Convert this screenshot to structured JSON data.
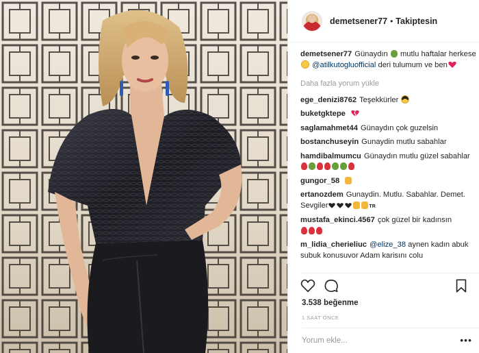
{
  "header": {
    "username": "demetsener77",
    "separator": "•",
    "follow_status": "Takiptesin"
  },
  "caption": {
    "user": "demetsener77",
    "text_1": "Günaydın",
    "text_2": "mutlu haftalar herkese",
    "mention": "@atilkutogluofficial",
    "text_3": "deri tulumum ve ben"
  },
  "load_more": "Daha fazla yorum yükle",
  "comments": [
    {
      "user": "ege_denizi8762",
      "text": "Teşekkürler"
    },
    {
      "user": "buketgktepe",
      "text": ""
    },
    {
      "user": "saglamahmet44",
      "text": "Günaydın çok guzelsin"
    },
    {
      "user": "bostanchuseyin",
      "text": "Gunaydin mutlu sabahlar"
    },
    {
      "user": "hamdibalmumcu",
      "text": "Günaydın mutlu güzel sabahlar"
    },
    {
      "user": "gungor_58",
      "text": ""
    },
    {
      "user": "ertanozdem",
      "text": "Gunaydin. Mutlu. Sabahlar. Demet. Sevgiler"
    },
    {
      "user": "mustafa_ekinci.4567",
      "text": "çok güzel bir kadınsın"
    },
    {
      "user": "m_lidia_cherieliuc",
      "mention": "@elize_38",
      "text": "aynen kadın abuk subuk konusuvor Adam karisını colu"
    }
  ],
  "actions": {
    "like_icon": "heart-outline-icon",
    "comment_icon": "speech-bubble-icon",
    "save_icon": "bookmark-icon"
  },
  "likes": "3.538 beğenme",
  "timestamp": "1 SAAT ÖNCE",
  "comment_input": {
    "placeholder": "Yorum ekle..."
  },
  "more_options": "•••",
  "tr_badge": "TR",
  "colors": {
    "link": "#003569",
    "muted": "#999999",
    "text": "#262626",
    "border": "#efefef"
  }
}
